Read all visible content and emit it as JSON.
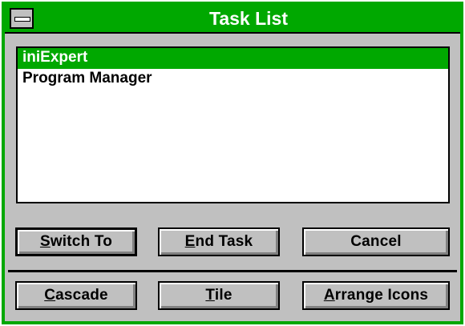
{
  "window": {
    "title": "Task List",
    "accent_color": "#00a800"
  },
  "tasks": [
    {
      "label": "iniExpert",
      "selected": true
    },
    {
      "label": "Program Manager",
      "selected": false
    }
  ],
  "buttons": {
    "switch_to": {
      "label": "Switch To",
      "mnemonic": "S"
    },
    "end_task": {
      "label": "End Task",
      "mnemonic": "E"
    },
    "cancel": {
      "label": "Cancel"
    },
    "cascade": {
      "label": "Cascade",
      "mnemonic": "C"
    },
    "tile": {
      "label": "Tile",
      "mnemonic": "T"
    },
    "arrange_icons": {
      "label": "Arrange Icons",
      "mnemonic": "A"
    }
  }
}
